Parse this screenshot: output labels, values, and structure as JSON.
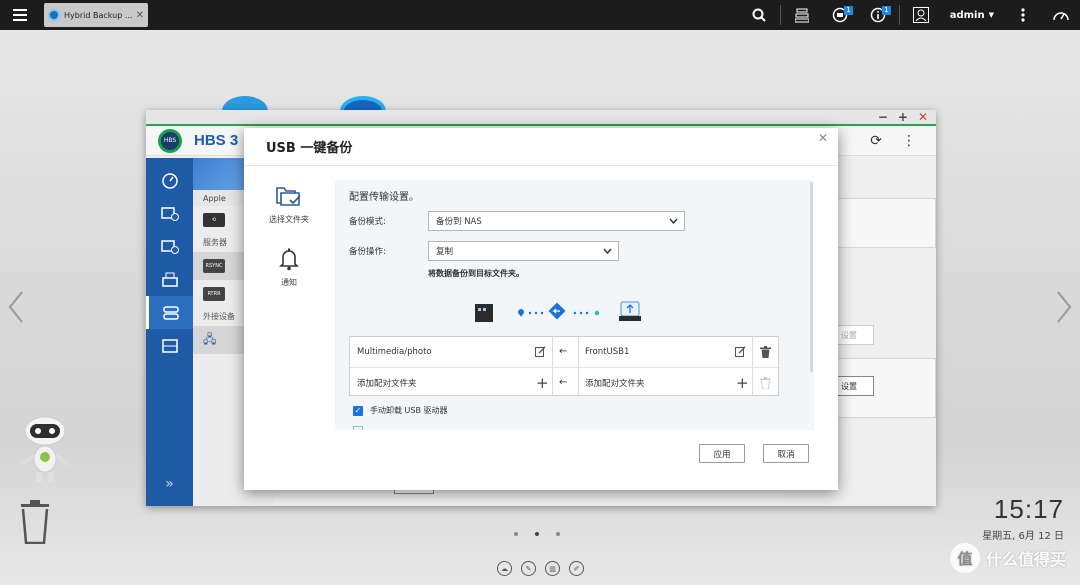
{
  "taskbar": {
    "app_tab_label": "Hybrid Backup ...",
    "user": "admin",
    "notification_badge": "1",
    "info_badge": "1"
  },
  "hbs_window": {
    "title": "HBS 3",
    "list_items": [
      "Apple",
      "服务器",
      "外接设备"
    ],
    "rsync_label": "RSYNC",
    "rtrr_label": "RTRR",
    "settings_button": "设置",
    "settings_button_2": "设置"
  },
  "modal": {
    "title": "USB 一键备份",
    "steps": [
      {
        "label": "选择文件夹",
        "icon": "folder-check-icon"
      },
      {
        "label": "通知",
        "icon": "bell-icon"
      }
    ],
    "config_title": "配置传输设置。",
    "backup_mode_label": "备份模式:",
    "backup_mode_value": "备份到 NAS",
    "backup_op_label": "备份操作:",
    "backup_op_value": "复制",
    "hint": "将数据备份到目标文件夹。",
    "pairs": [
      {
        "nas_folder": "Multimedia/photo",
        "usb_folder": "FrontUSB1"
      }
    ],
    "add_nas_placeholder": "添加配对文件夹",
    "add_usb_placeholder": "添加配对文件夹",
    "checkbox_label": "手动卸载 USB 驱动器",
    "apply_button": "应用",
    "cancel_button": "取消"
  },
  "desktop": {
    "time": "15:17",
    "date": "星期五, 6月 12 日",
    "watermark": "什么值得买",
    "watermark_glyph": "值"
  },
  "colors": {
    "nav_blue": "#1f5aa6",
    "hbs_title_blue": "#1f5ea8",
    "accent_green": "#27a24d",
    "checkbox_blue": "#1e73d8"
  }
}
